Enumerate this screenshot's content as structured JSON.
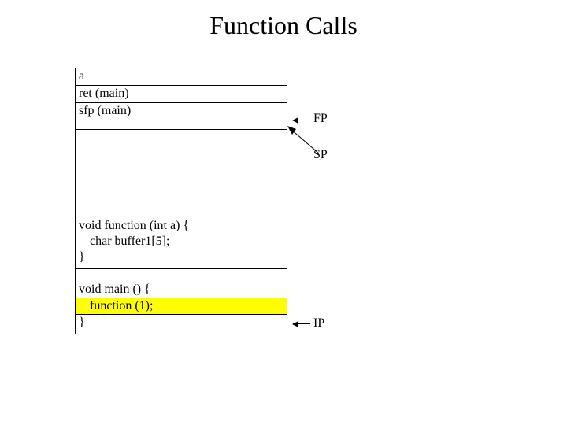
{
  "title": "Function Calls",
  "stack": {
    "r0": "a",
    "r1": "ret (main)",
    "r2": "sfp (main)"
  },
  "code": {
    "fn_sig": "void function (int a) {",
    "fn_decl": "char buffer1[5];",
    "fn_close": "}",
    "main_sig": "void main () {",
    "main_call": "function (1);",
    "main_close": "}"
  },
  "pointers": {
    "fp": "FP",
    "sp": "SP",
    "ip": "IP"
  }
}
